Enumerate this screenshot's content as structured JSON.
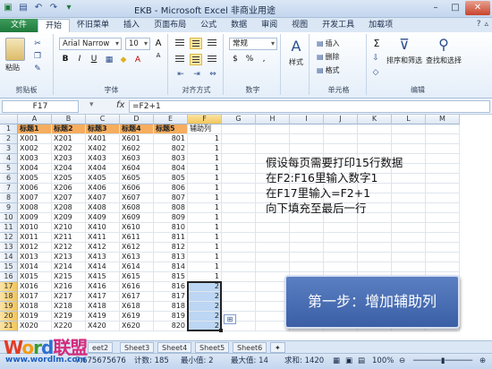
{
  "window": {
    "title": "EKB - Microsoft Excel 非商业用途",
    "minimize": "–",
    "maximize": "□",
    "close": "✕"
  },
  "tabs": [
    {
      "label": "文件"
    },
    {
      "label": "开始"
    },
    {
      "label": "怀旧菜单"
    },
    {
      "label": "插入"
    },
    {
      "label": "页面布局"
    },
    {
      "label": "公式"
    },
    {
      "label": "数据"
    },
    {
      "label": "审阅"
    },
    {
      "label": "视图"
    },
    {
      "label": "开发工具"
    },
    {
      "label": "加载项"
    }
  ],
  "ribbon": {
    "clipboard": {
      "paste": "粘贴",
      "label": "剪贴板"
    },
    "font": {
      "name": "Arial Narrow",
      "size": "10",
      "label": "字体",
      "bold": "B",
      "italic": "I",
      "underline": "U",
      "grow": "A",
      "shrink": "A"
    },
    "alignment": {
      "label": "对齐方式"
    },
    "number": {
      "format": "常规",
      "label": "数字",
      "percent": "%",
      "comma": ",",
      "currency": "$"
    },
    "styles": {
      "label": "样式"
    },
    "cells": {
      "insert": "插入",
      "delete": "删除",
      "format": "格式",
      "label": "单元格"
    },
    "editing": {
      "sort": "排序和筛选",
      "find": "查找和选择",
      "label": "编辑",
      "sum": "Σ"
    }
  },
  "formula_bar": {
    "name_box": "F17",
    "fx": "fx",
    "formula": "=F2+1"
  },
  "grid": {
    "columns": [
      "A",
      "B",
      "C",
      "D",
      "E",
      "F",
      "G",
      "H",
      "I",
      "J",
      "K",
      "L",
      "M"
    ],
    "header_row": [
      "标题1",
      "标题2",
      "标题3",
      "标题4",
      "标题5",
      "辅助列"
    ],
    "rows": [
      [
        "X001",
        "X201",
        "X401",
        "X601",
        "801",
        "1"
      ],
      [
        "X002",
        "X202",
        "X402",
        "X602",
        "802",
        "1"
      ],
      [
        "X003",
        "X203",
        "X403",
        "X603",
        "803",
        "1"
      ],
      [
        "X004",
        "X204",
        "X404",
        "X604",
        "804",
        "1"
      ],
      [
        "X005",
        "X205",
        "X405",
        "X605",
        "805",
        "1"
      ],
      [
        "X006",
        "X206",
        "X406",
        "X606",
        "806",
        "1"
      ],
      [
        "X007",
        "X207",
        "X407",
        "X607",
        "807",
        "1"
      ],
      [
        "X008",
        "X208",
        "X408",
        "X608",
        "808",
        "1"
      ],
      [
        "X009",
        "X209",
        "X409",
        "X609",
        "809",
        "1"
      ],
      [
        "X010",
        "X210",
        "X410",
        "X610",
        "810",
        "1"
      ],
      [
        "X011",
        "X211",
        "X411",
        "X611",
        "811",
        "1"
      ],
      [
        "X012",
        "X212",
        "X412",
        "X612",
        "812",
        "1"
      ],
      [
        "X013",
        "X213",
        "X413",
        "X613",
        "813",
        "1"
      ],
      [
        "X014",
        "X214",
        "X414",
        "X614",
        "814",
        "1"
      ],
      [
        "X015",
        "X215",
        "X415",
        "X615",
        "815",
        "1"
      ],
      [
        "X016",
        "X216",
        "X416",
        "X616",
        "816",
        "2"
      ],
      [
        "X017",
        "X217",
        "X417",
        "X617",
        "817",
        "2"
      ],
      [
        "X018",
        "X218",
        "X418",
        "X618",
        "818",
        "2"
      ],
      [
        "X019",
        "X219",
        "X419",
        "X619",
        "819",
        "2"
      ],
      [
        "X020",
        "X220",
        "X420",
        "X620",
        "820",
        "2"
      ]
    ],
    "row_numbers": [
      "1",
      "2",
      "3",
      "4",
      "5",
      "6",
      "7",
      "8",
      "9",
      "10",
      "11",
      "12",
      "13",
      "14",
      "15",
      "16",
      "17",
      "18",
      "19",
      "20",
      "21"
    ],
    "selected_col": "F",
    "selected_rows": [
      "17",
      "18",
      "19",
      "20",
      "21"
    ]
  },
  "note": [
    "假设每页需要打印15行数据",
    "在F2:F16里输入数字1",
    "在F17里输入=F2+1",
    "向下填充至最后一行"
  ],
  "callout": "第一步：增加辅助列",
  "sheets": [
    "eet2",
    "Sheet3",
    "Sheet4",
    "Sheet5",
    "Sheet6"
  ],
  "status": {
    "average": "7.675675676",
    "count": "计数: 185",
    "max": "最小值: 2",
    "min": "最大值: 14",
    "sum": "求和: 1420",
    "zoom": "100%"
  },
  "watermark": {
    "brand_w": "W",
    "brand_o": "o",
    "brand_r": "r",
    "brand_d": "d",
    "brand_cn": "联盟",
    "url": "www.wordlm.com"
  },
  "colors": {
    "header_fill": "#f6ad5e",
    "selection_fill": "#bcd6f3",
    "callout_fill": "#3b5fa5",
    "file_tab": "#1f7a3c"
  }
}
